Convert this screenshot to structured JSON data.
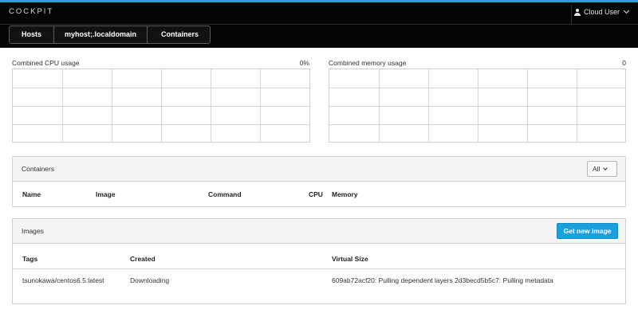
{
  "header": {
    "brand": "COCKPIT",
    "user_label": "Cloud User",
    "user_icon": "user-icon",
    "menu_icon": "chevron-down-icon"
  },
  "breadcrumbs": [
    "Hosts",
    "myhost;.localdomain",
    "Containers"
  ],
  "cpu_chart": {
    "label": "Combined CPU usage",
    "value": "0%"
  },
  "memory_chart": {
    "label": "Combined memory usage",
    "value": "0"
  },
  "containers": {
    "title": "Containers",
    "filter_label": "All",
    "columns": [
      "Name",
      "Image",
      "Command",
      "CPU",
      "Memory"
    ]
  },
  "images": {
    "title": "Images",
    "button_label": "Get new image",
    "columns": [
      "Tags",
      "Created",
      "Virtual Size"
    ],
    "rows": [
      {
        "tag": "tsunokawa/centos6.5:latest",
        "created": "Downloading",
        "size": "609ab72acf20: Pulling dependent layers    2d3becd5b5c7: Pulling metadata"
      }
    ]
  },
  "colors": {
    "accent": "#2a9fd6",
    "button": "#1ca0dd",
    "topbar": "#050505"
  }
}
